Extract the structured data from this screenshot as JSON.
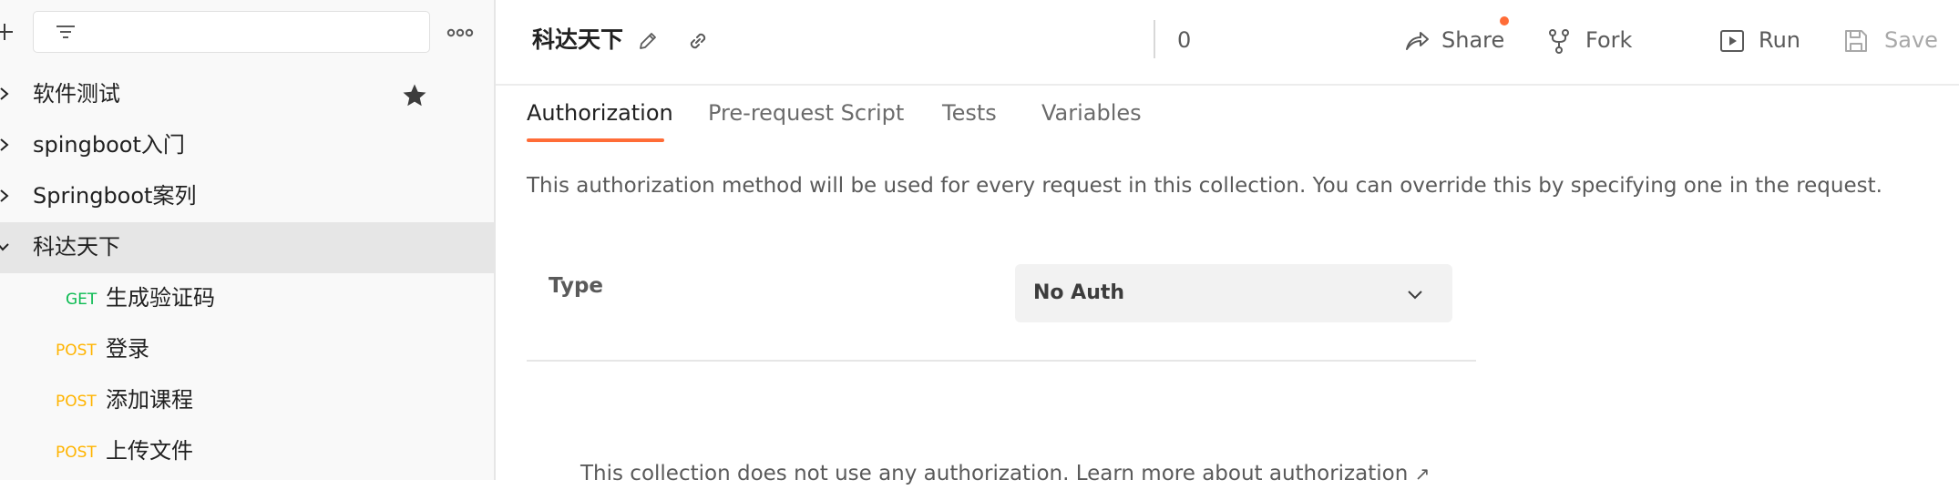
{
  "sidebar": {
    "items": [
      {
        "label": "软件测试",
        "expanded": false,
        "starred": true
      },
      {
        "label": "spingboot入门",
        "expanded": false
      },
      {
        "label": "Springboot案列",
        "expanded": false
      },
      {
        "label": "科达天下",
        "expanded": true,
        "selected": true
      }
    ],
    "requests": [
      {
        "method": "GET",
        "name": "生成验证码"
      },
      {
        "method": "POST",
        "name": "登录"
      },
      {
        "method": "POST",
        "name": "添加课程"
      },
      {
        "method": "POST",
        "name": "上传文件"
      }
    ]
  },
  "header": {
    "title": "科达天下",
    "share_label": "Share",
    "fork_label": "Fork",
    "fork_count": "0",
    "run_label": "Run",
    "save_label": "Save"
  },
  "tabs": [
    {
      "label": "Authorization",
      "active": true
    },
    {
      "label": "Pre-request Script"
    },
    {
      "label": "Tests"
    },
    {
      "label": "Variables"
    }
  ],
  "auth": {
    "description": "This authorization method will be used for every request in this collection. You can override this by specifying one in the request.",
    "type_label": "Type",
    "type_value": "No Auth",
    "note": "This collection does not use any authorization. Learn more about authorization",
    "note_arrow": "↗"
  },
  "colors": {
    "accent": "#ff6c37",
    "get": "#0cbb52",
    "post": "#ffb400"
  }
}
